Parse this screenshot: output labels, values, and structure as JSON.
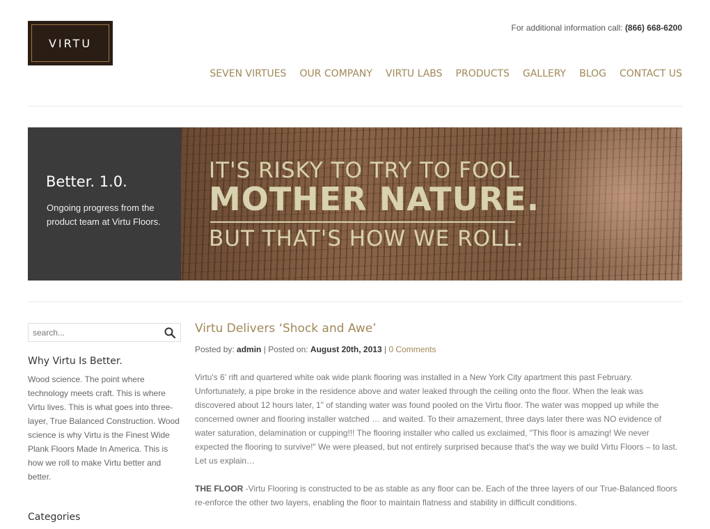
{
  "header": {
    "logo_text": "VIRTU",
    "contact_prefix": "For additional information call:",
    "contact_phone": "(866) 668-6200",
    "nav": [
      "SEVEN VIRTUES",
      "OUR COMPANY",
      "VIRTU LABS",
      "PRODUCTS",
      "GALLERY",
      "BLOG",
      "CONTACT US"
    ]
  },
  "hero": {
    "title": "Better. 1.0.",
    "subtitle": "Ongoing progress from the product team at Virtu Floors.",
    "banner_line1": "IT'S RISKY TO TRY TO FOOL",
    "banner_line2": "MOTHER NATURE.",
    "banner_line3": "BUT THAT'S HOW WE ROLL."
  },
  "sidebar": {
    "search_placeholder": "search...",
    "search_icon": "search-icon",
    "why_heading": "Why Virtu Is Better.",
    "why_text": "Wood science. The point where technology meets craft. This is where Virtu lives. This is what goes into three-layer, True Balanced Construction. Wood science is why Virtu is the Finest Wide Plank Floors Made In America. This is how we roll to make Virtu better and better.",
    "categories_heading": "Categories"
  },
  "post": {
    "title": "Virtu Delivers ‘Shock and Awe’",
    "posted_by_label": "Posted by:",
    "author": "admin",
    "sep1": "|",
    "posted_on_label": "Posted on:",
    "date": "August 20th, 2013",
    "sep2": "|",
    "comments": "0 Comments",
    "para1": "Virtu's 6' rift and quartered white oak wide plank flooring was installed in a New York City apartment this past February. Unfortunately, a pipe broke in the residence above and water leaked through the ceiling onto the floor. When the leak was discovered about 12 hours later, 1\" of standing water was found pooled on the Virtu floor. The water was mopped up while the concerned owner and flooring installer watched … and waited. To their amazement, three days later there was NO evidence of water saturation, delamination or cupping!!! The flooring installer who called us exclaimed, \"This floor is amazing! We never expected the flooring to survive!\" We were pleased, but not entirely surprised because that's the way we build Virtu Floors – to last. Let us explain…",
    "para2_lead": "THE FLOOR",
    "para2_text": " -Virtu Flooring is constructed to be as stable as any floor can be. Each of the three layers of our True-Balanced floors re-enforce the other two layers, enabling the floor to maintain flatness and stability in difficult conditions."
  },
  "colors": {
    "accent": "#a08858",
    "hero_panel": "#3b3b3b",
    "logo_bg": "#2a1d14",
    "banner_text": "#d8d2ae"
  }
}
